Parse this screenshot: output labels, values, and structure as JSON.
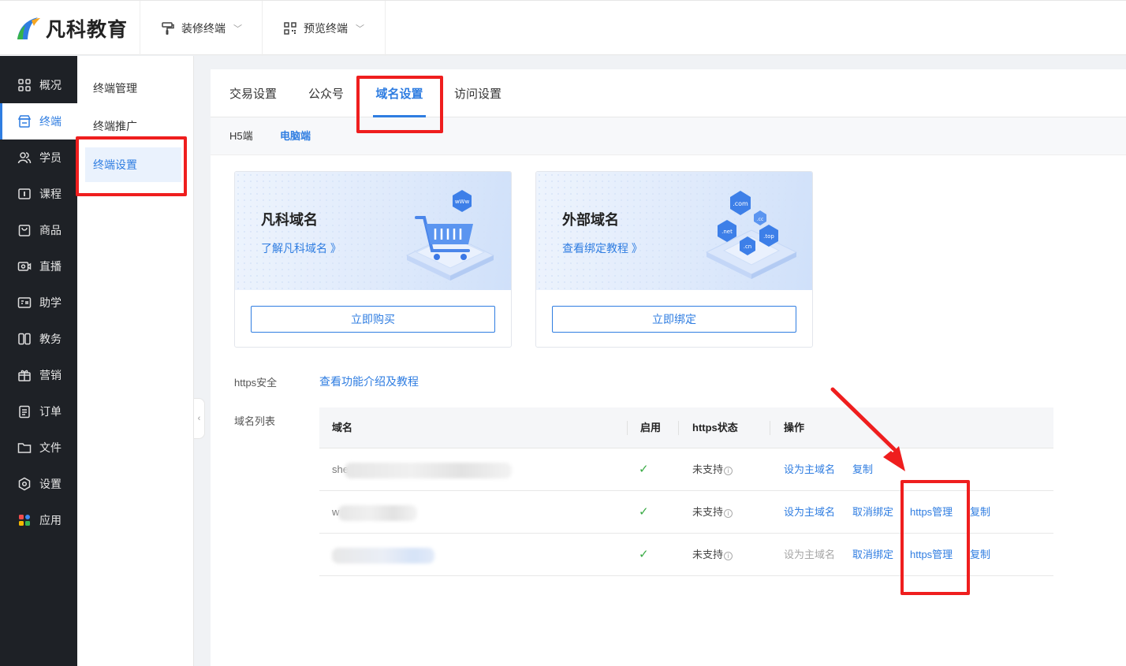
{
  "app": {
    "name": "凡科教育"
  },
  "top_menu": [
    {
      "label": "装修终端"
    },
    {
      "label": "预览终端"
    }
  ],
  "left_nav": [
    {
      "label": "概况",
      "icon": "grid-icon"
    },
    {
      "label": "终端",
      "icon": "shop-icon",
      "active": true
    },
    {
      "label": "学员",
      "icon": "users-icon"
    },
    {
      "label": "课程",
      "icon": "course-icon"
    },
    {
      "label": "商品",
      "icon": "bag-icon"
    },
    {
      "label": "直播",
      "icon": "live-icon"
    },
    {
      "label": "助学",
      "icon": "study-icon"
    },
    {
      "label": "教务",
      "icon": "book-icon"
    },
    {
      "label": "营销",
      "icon": "gift-icon"
    },
    {
      "label": "订单",
      "icon": "order-icon"
    },
    {
      "label": "文件",
      "icon": "folder-icon"
    },
    {
      "label": "设置",
      "icon": "settings-icon"
    },
    {
      "label": "应用",
      "icon": "apps-icon"
    }
  ],
  "sub_nav": [
    {
      "label": "终端管理"
    },
    {
      "label": "终端推广"
    },
    {
      "label": "终端设置",
      "active": true
    }
  ],
  "tabs": [
    {
      "label": "交易设置"
    },
    {
      "label": "公众号"
    },
    {
      "label": "域名设置",
      "active": true
    },
    {
      "label": "访问设置"
    }
  ],
  "sub_tabs": [
    {
      "label": "H5端"
    },
    {
      "label": "电脑端",
      "active": true
    }
  ],
  "cards": [
    {
      "title": "凡科域名",
      "link": "了解凡科域名 》",
      "button": "立即购买",
      "badge": "wWw"
    },
    {
      "title": "外部域名",
      "link": "查看绑定教程 》",
      "button": "立即绑定",
      "badges": [
        ".com",
        ".cc",
        ".net",
        ".top",
        ".cn"
      ]
    }
  ],
  "https_section": {
    "label": "https安全",
    "link": "查看功能介绍及教程"
  },
  "domain_list": {
    "label": "域名列表",
    "columns": [
      "域名",
      "启用",
      "https状态",
      "操作"
    ],
    "rows": [
      {
        "domain_prefix": "she",
        "enabled": "✓",
        "https_status": "未支持",
        "actions": [
          "设为主域名",
          "复制"
        ]
      },
      {
        "domain_prefix": "w",
        "enabled": "✓",
        "https_status": "未支持",
        "actions": [
          "设为主域名",
          "取消绑定",
          "https管理",
          "复制"
        ]
      },
      {
        "domain_prefix": "",
        "enabled": "✓",
        "https_status": "未支持",
        "actions": [
          "设为主域名",
          "取消绑定",
          "https管理",
          "复制"
        ]
      }
    ]
  },
  "colors": {
    "accent": "#2f7de1",
    "highlight": "#ef1e1e",
    "nav_bg": "#1e2126",
    "success": "#3aab45"
  }
}
